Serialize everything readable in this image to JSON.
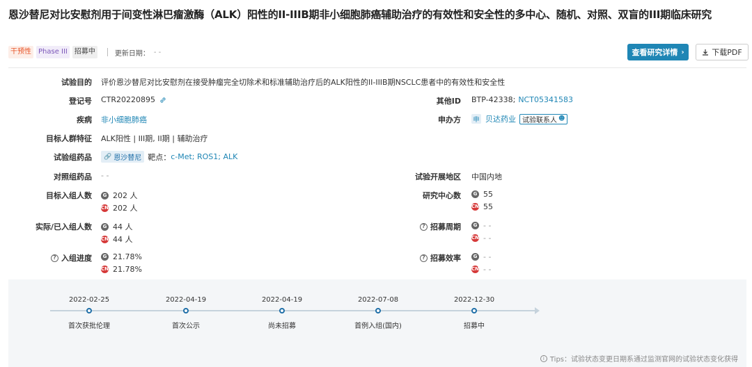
{
  "title": "恩沙替尼对比安慰剂用于间变性淋巴瘤激酶（ALK）阳性的II-IIIB期非小细胞肺癌辅助治疗的有效性和安全性的多中心、随机、对照、双盲的III期临床研究",
  "tags": [
    "干预性",
    "Phase III",
    "招募中"
  ],
  "update": {
    "label": "更新日期：",
    "value": "- -"
  },
  "buttons": {
    "detail": "查看研究详情",
    "pdf": "下载PDF"
  },
  "fields": {
    "purpose": {
      "label": "试验目的",
      "value": "评价恩沙替尼对比安慰剂在接受肿瘤完全切除术和标准辅助治疗后的ALK阳性的II-IIIB期NSCLC患者中的有效性和安全性"
    },
    "reg_no": {
      "label": "登记号",
      "value": "CTR20220895"
    },
    "other_id": {
      "label": "其他ID",
      "value_prefix": "BTP-42338;",
      "value_link": "NCT05341583"
    },
    "disease": {
      "label": "疾病",
      "value": "非小细胞肺癌"
    },
    "sponsor": {
      "label": "申办方",
      "badge": "申",
      "value": "贝达药业",
      "contact": "试验联系人"
    },
    "population": {
      "label": "目标人群特征",
      "value": "ALK阳性 | III期, II期 | 辅助治疗"
    },
    "test_drug": {
      "label": "试验组药品",
      "drug": "恩沙替尼",
      "target_label": "靶点：",
      "targets": "c-Met; ROS1; ALK"
    },
    "control_drug": {
      "label": "对照组药品",
      "value": "- -"
    },
    "region": {
      "label": "试验开展地区",
      "value": "中国内地"
    },
    "target_enroll": {
      "label": "目标入组人数",
      "g": "202 人",
      "cn": "202 人"
    },
    "centers": {
      "label": "研究中心数",
      "g": "55",
      "cn": "55"
    },
    "actual_enroll": {
      "label": "实际/已入组人数",
      "g": "44 人",
      "cn": "44 人"
    },
    "recruit_period": {
      "label": "招募周期",
      "g": "- -",
      "cn": "- -"
    },
    "progress": {
      "label": "入组进度",
      "g": "21.78%",
      "cn": "21.78%"
    },
    "efficiency": {
      "label": "招募效率",
      "g": "- -",
      "cn": "- -"
    }
  },
  "source_icons": {
    "g": "G",
    "cn": "CN"
  },
  "timeline": [
    {
      "date": "2022-02-25",
      "label": "首次获批伦理"
    },
    {
      "date": "2022-04-19",
      "label": "首次公示"
    },
    {
      "date": "2022-04-19",
      "label": "尚未招募"
    },
    {
      "date": "2022-07-08",
      "label": "首例入组(国内)"
    },
    {
      "date": "2022-12-30",
      "label": "招募中"
    }
  ],
  "tips": "Tips：试验状态变更日期系通过监测官网的试验状态变化获得",
  "colors": {
    "accent": "#1f86b5",
    "cn_red": "#d63a3a",
    "tag_orange": "#e8562a",
    "tag_purple": "#7a55b8"
  }
}
